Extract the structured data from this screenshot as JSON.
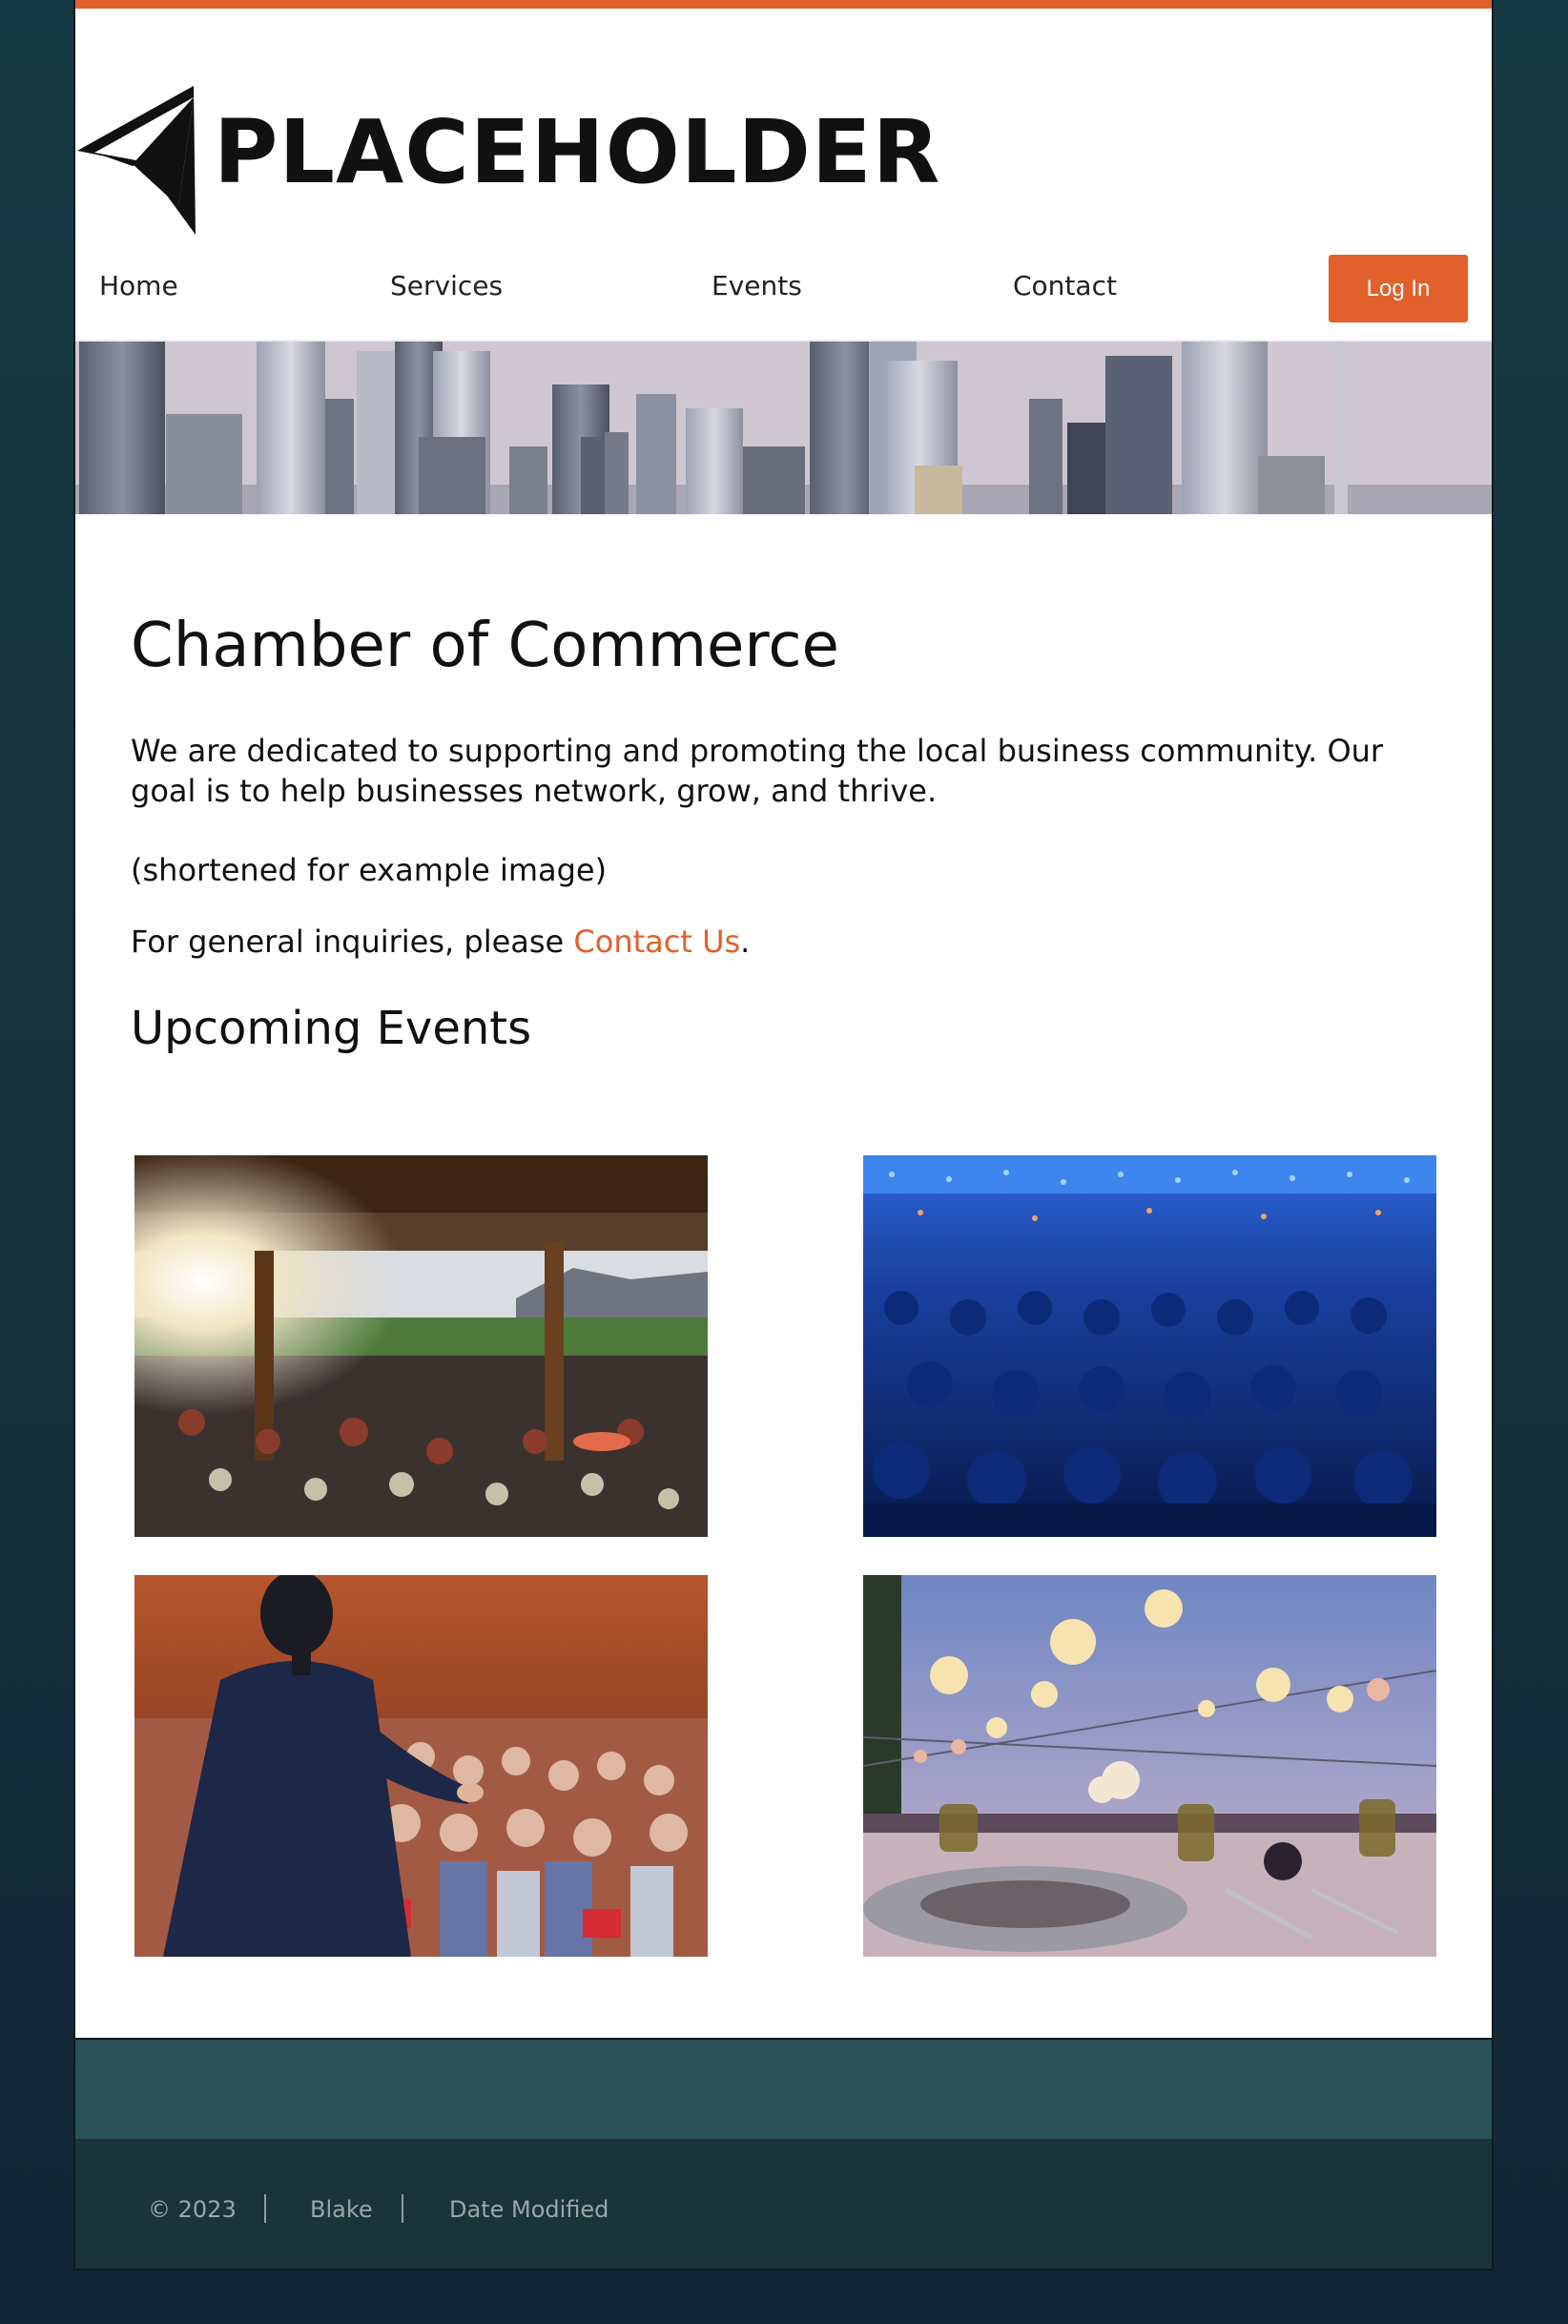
{
  "brand": {
    "name": "PLACEHOLDER",
    "accent_color": "#e2602b",
    "logo_icon": "paper-plane-logo-icon"
  },
  "nav": {
    "items": [
      {
        "label": "Home"
      },
      {
        "label": "Services"
      },
      {
        "label": "Events"
      },
      {
        "label": "Contact"
      }
    ],
    "login_label": "Log In"
  },
  "banner": {
    "image": "city-skyline-banner-image"
  },
  "main": {
    "title": "Chamber of Commerce",
    "intro": "We are dedicated to supporting and promoting the local business community. Our goal is to help businesses network, grow, and thrive.",
    "note": "(shortened for example image)",
    "inquiry_prefix": "For general inquiries, please ",
    "inquiry_link": "Contact Us",
    "inquiry_suffix": ".",
    "events_title": "Upcoming Events"
  },
  "events": [
    {
      "image": "outdoor-pavilion-crowd-image"
    },
    {
      "image": "blue-conference-audience-image"
    },
    {
      "image": "speaker-presentation-image"
    },
    {
      "image": "lantern-dinner-party-image"
    }
  ],
  "footer": {
    "copyright": "© 2023",
    "author": "Blake",
    "modified": "Date Modified",
    "top_color": "#2b5058",
    "bottom_color": "#1b333b"
  }
}
